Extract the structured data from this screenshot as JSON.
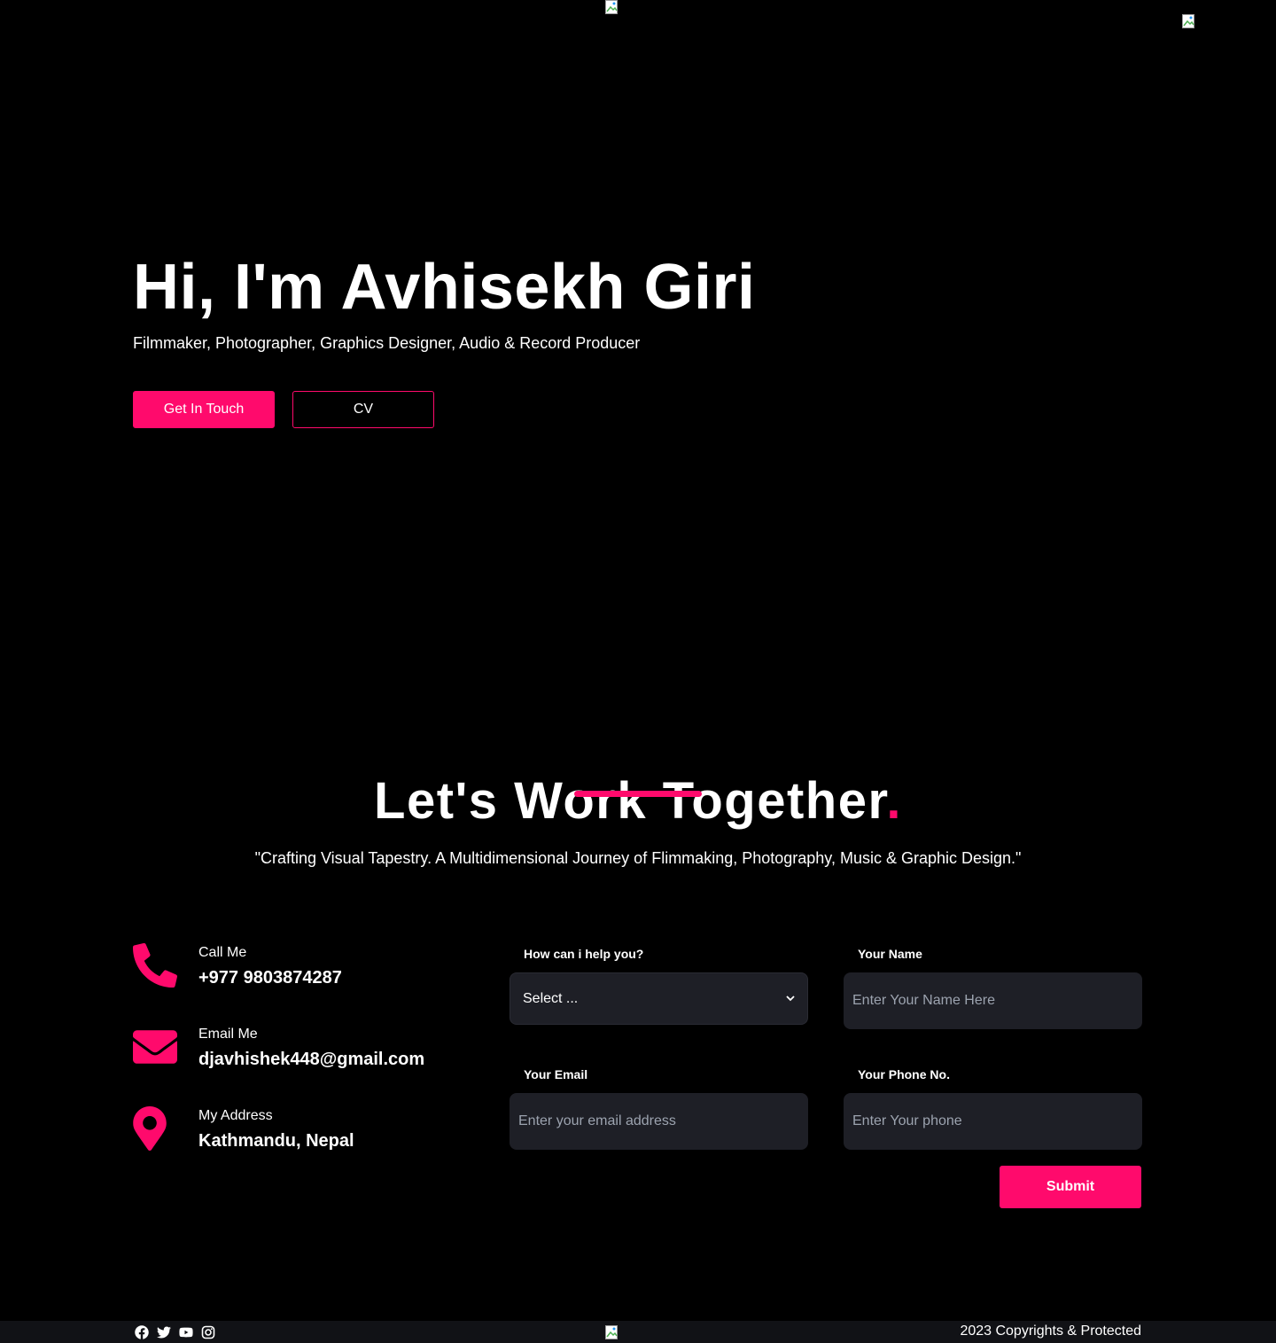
{
  "header": {
    "logo_alt": "",
    "menu_alt": ""
  },
  "hero": {
    "title": "Hi, I'm Avhisekh Giri",
    "roles": "Filmmaker, Photographer, Graphics Designer, Audio & Record Producer",
    "primary_button": "Get In Touch",
    "secondary_button": "CV"
  },
  "work": {
    "title": "Let's Work Together",
    "title_dot": ".",
    "tagline": "\"Crafting Visual Tapestry. A Multidimensional Journey of Flimmaking, Photography, Music & Graphic Design.\""
  },
  "contact": {
    "items": [
      {
        "label": "Call Me",
        "value": "+977 9803874287",
        "icon": "phone-icon"
      },
      {
        "label": "Email Me",
        "value": "djavhishek448@gmail.com",
        "icon": "envelope-icon"
      },
      {
        "label": "My Address",
        "value": "Kathmandu, Nepal",
        "icon": "map-pin-icon"
      }
    ]
  },
  "form": {
    "help_label": "How can i help you?",
    "help_selected": "Select ...",
    "name_label": "Your Name",
    "name_placeholder": "Enter Your Name Here",
    "email_label": "Your Email",
    "email_placeholder": "Enter your email address",
    "phone_label": "Your Phone No.",
    "phone_placeholder": "Enter Your phone",
    "submit_label": "Submit"
  },
  "footer": {
    "socials": [
      "facebook-icon",
      "twitter-icon",
      "youtube-icon",
      "instagram-icon"
    ],
    "copyright": "2023 Copyrights & Protected"
  },
  "colors": {
    "accent": "#ff0a6c",
    "background": "#000000",
    "field_bg": "#1e1f26",
    "footer_bg": "#111216"
  }
}
